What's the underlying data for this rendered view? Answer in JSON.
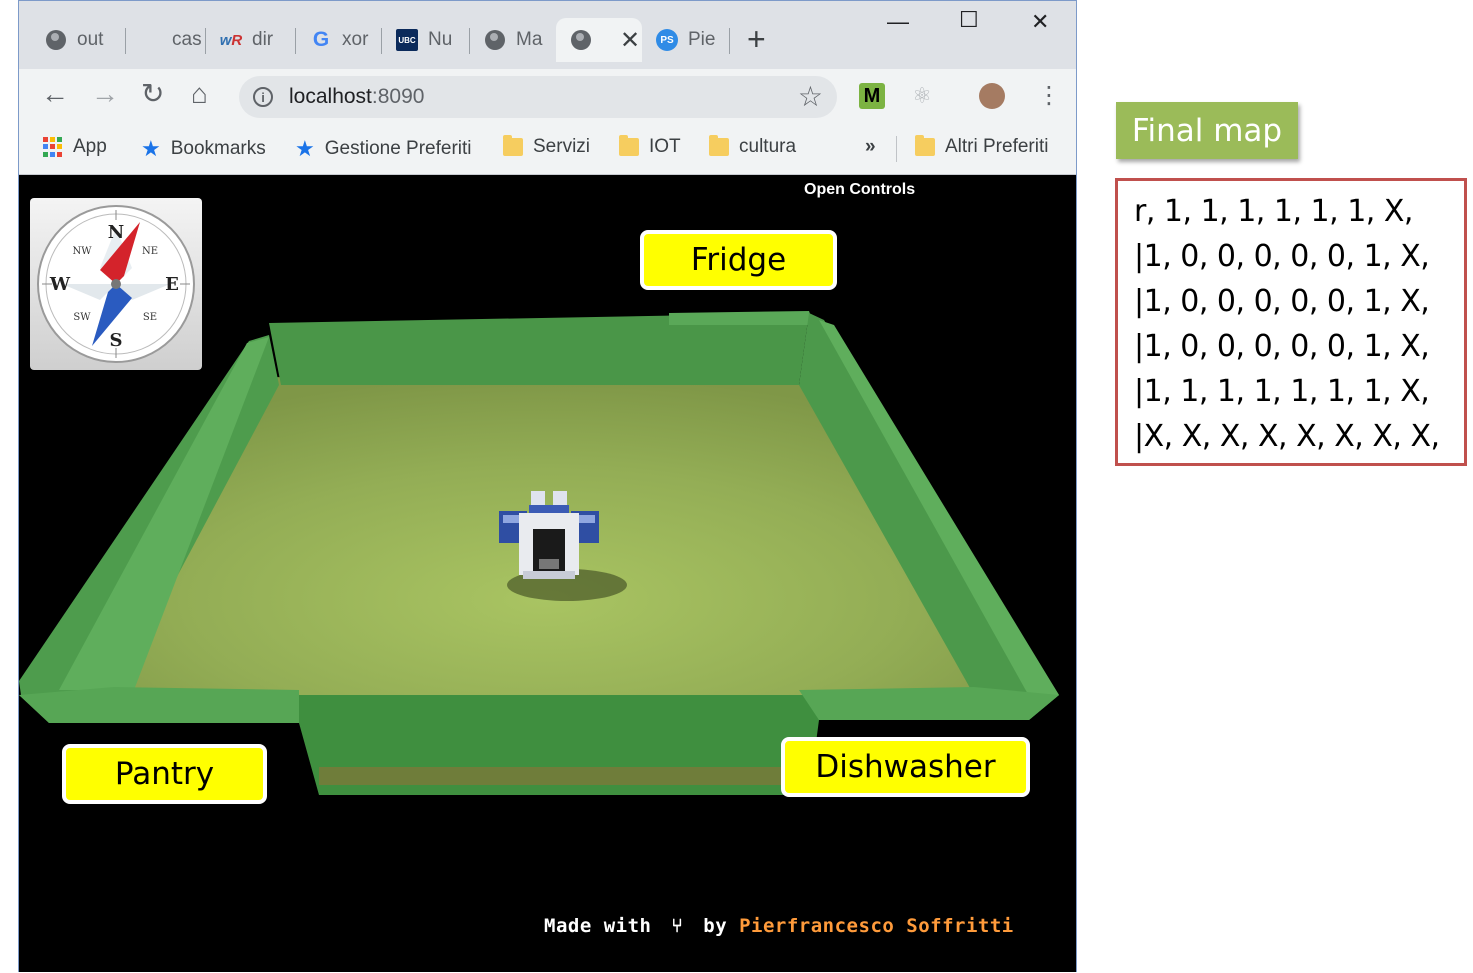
{
  "browser": {
    "tabs": [
      {
        "title": "out",
        "icon": "globe-icon"
      },
      {
        "title": "cas",
        "icon": "blank-icon"
      },
      {
        "title": "dir",
        "icon": "wordreference-icon"
      },
      {
        "title": "xor",
        "icon": "google-icon"
      },
      {
        "title": "Nu",
        "icon": "ubc-icon"
      },
      {
        "title": "Ma",
        "icon": "globe-icon"
      },
      {
        "title": "",
        "icon": "globe-icon",
        "active": true
      },
      {
        "title": "Pie",
        "icon": "ps-icon"
      }
    ],
    "url_host": "localhost",
    "url_port": ":8090",
    "bookmarks": [
      {
        "label": "App",
        "icon": "apps-grid-icon"
      },
      {
        "label": "Bookmarks",
        "icon": "star-icon"
      },
      {
        "label": "Gestione Preferiti",
        "icon": "star-icon"
      },
      {
        "label": "Servizi",
        "icon": "folder-icon"
      },
      {
        "label": "IOT",
        "icon": "folder-icon"
      },
      {
        "label": "cultura",
        "icon": "folder-icon"
      },
      {
        "label": "»",
        "icon": "overflow-chevron-icon"
      },
      {
        "label": "Altri Preferiti",
        "icon": "folder-icon"
      }
    ]
  },
  "app": {
    "open_controls": "Open Controls",
    "compass_letters": {
      "n": "N",
      "s": "S",
      "e": "E",
      "w": "W",
      "ne": "NE",
      "nw": "NW",
      "se": "SE",
      "sw": "SW"
    },
    "credit_made_with": "Made with",
    "credit_by": "by",
    "credit_author": "Pierfrancesco Soffritti",
    "room_floor_color": "#9db75e",
    "room_wall_color": "#4e9a4e"
  },
  "labels": {
    "fridge": "Fridge",
    "pantry": "Pantry",
    "dishwasher": "Dishwasher",
    "label_color": "#ffff00"
  },
  "final_map": {
    "title": "Final map",
    "rows": [
      "r, 1, 1, 1, 1, 1, 1, X,",
      "|1, 0, 0, 0, 0, 0, 1, X,",
      "|1, 0, 0, 0, 0, 0, 1, X,",
      "|1, 0, 0, 0, 0, 0, 1, X,",
      "|1, 1, 1, 1, 1, 1, 1, X,",
      "|X, X, X, X, X, X, X, X,"
    ],
    "title_color": "#9bbb59",
    "border_color": "#c0504d"
  }
}
